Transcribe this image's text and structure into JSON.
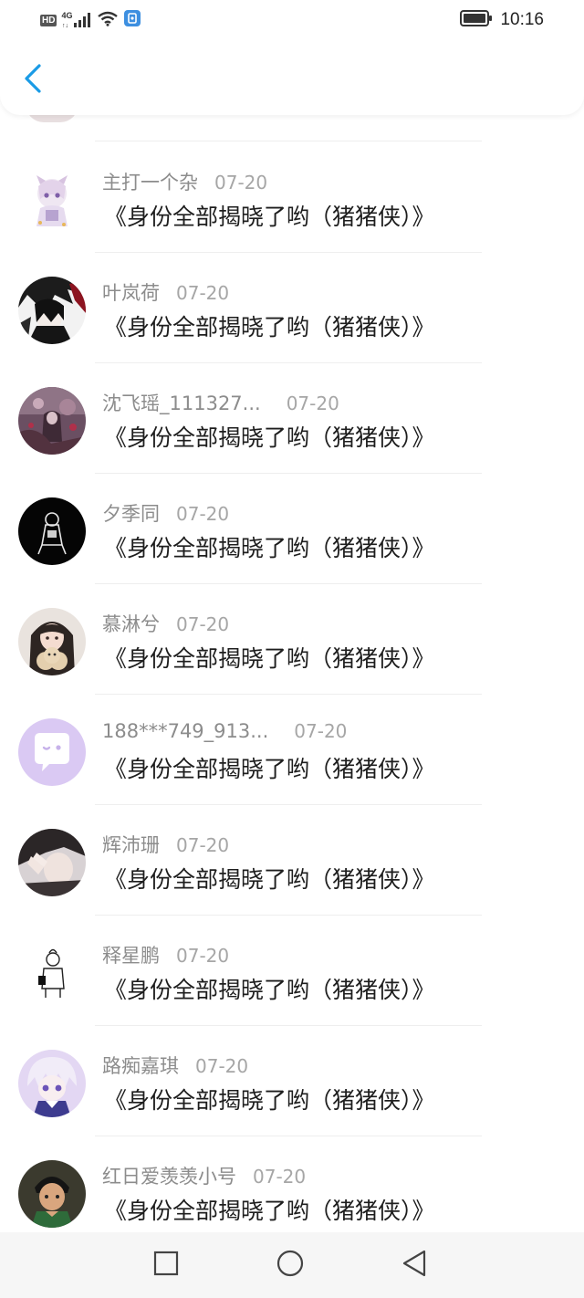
{
  "status_bar": {
    "hd_label": "HD",
    "network_label": "4G",
    "time": "10:16"
  },
  "header": {
    "back_icon": "chevron-left-icon",
    "accent_color": "#1a9be6"
  },
  "rows": [
    {
      "name": "主打一个杂",
      "date": "07-20",
      "message": "《身份全部揭晓了哟（猪猪侠）》",
      "avatar": "anime-girl-avatar"
    },
    {
      "name": "叶岚荷",
      "date": "07-20",
      "message": "《身份全部揭晓了哟（猪猪侠）》",
      "avatar": "dark-anime-avatar"
    },
    {
      "name": "沈飞瑶_111327...",
      "date": "07-20",
      "message": "《身份全部揭晓了哟（猪猪侠）》",
      "avatar": "purple-art-avatar"
    },
    {
      "name": "夕季同",
      "date": "07-20",
      "message": "《身份全部揭晓了哟（猪猪侠）》",
      "avatar": "black-sketch-avatar"
    },
    {
      "name": "慕淋兮",
      "date": "07-20",
      "message": "《身份全部揭晓了哟（猪猪侠）》",
      "avatar": "girl-photo-avatar"
    },
    {
      "name": "188***749_913...",
      "date": "07-20",
      "message": "《身份全部揭晓了哟（猪猪侠）》",
      "avatar": "default-chat-avatar"
    },
    {
      "name": "辉沛珊",
      "date": "07-20",
      "message": "《身份全部揭晓了哟（猪猪侠）》",
      "avatar": "hand-photo-avatar"
    },
    {
      "name": "释星鹏",
      "date": "07-20",
      "message": "《身份全部揭晓了哟（猪猪侠）》",
      "avatar": "line-drawing-avatar"
    },
    {
      "name": "路痴嘉琪",
      "date": "07-20",
      "message": "《身份全部揭晓了哟（猪猪侠）》",
      "avatar": "silver-hair-anime-avatar"
    },
    {
      "name": "红日爱羡羡小号",
      "date": "07-20",
      "message": "《身份全部揭晓了哟（猪猪侠）》",
      "avatar": "cartoon-boy-avatar"
    }
  ],
  "nav_bar": {
    "recent_icon": "square-icon",
    "home_icon": "circle-icon",
    "back_icon": "triangle-back-icon"
  }
}
